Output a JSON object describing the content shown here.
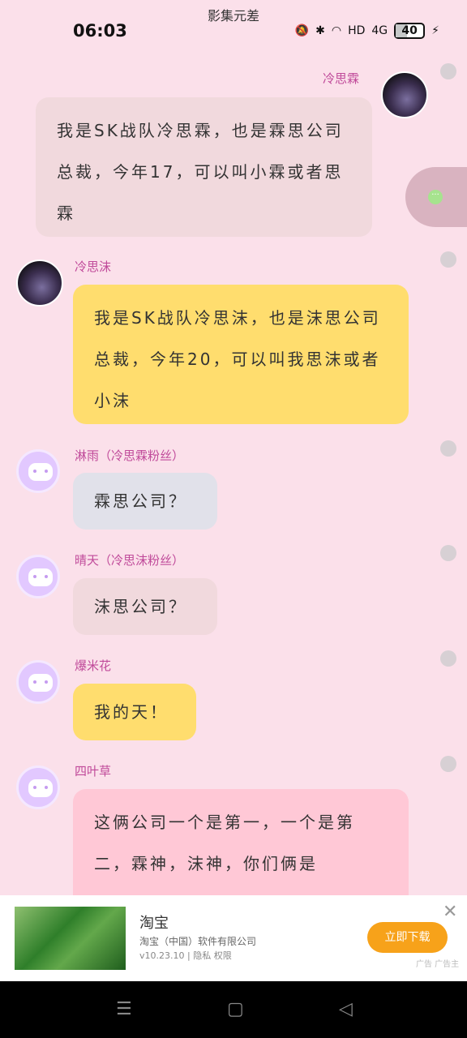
{
  "status_bar": {
    "top_title": "影集元差",
    "time": "06:03",
    "battery": "40",
    "net": "4G",
    "hd": "HD"
  },
  "messages": [
    {
      "name": "冷思霖",
      "text": "我是SK战队冷思霖，也是霖思公司总裁，今年17，可以叫小霖或者思霖",
      "side": "right"
    },
    {
      "name": "冷思沫",
      "text": "我是SK战队冷思沫，也是沫思公司总裁，今年20，可以叫我思沫或者小沫",
      "side": "left"
    },
    {
      "name": "淋雨（冷思霖粉丝）",
      "text": "霖思公司？",
      "side": "left"
    },
    {
      "name": "晴天（冷思沫粉丝）",
      "text": "沫思公司？",
      "side": "left"
    },
    {
      "name": "爆米花",
      "text": "我的天！",
      "side": "left"
    },
    {
      "name": "四叶草",
      "text": "这俩公司一个是第一，一个是第二，霖神，沫神，你们俩是",
      "side": "left"
    }
  ],
  "ad": {
    "title": "淘宝",
    "desc": "淘宝（中国）软件有限公司",
    "version": "v10.23.10 | 隐私 权限",
    "button": "立即下载",
    "tag": "广告 广告主",
    "close": "✕"
  },
  "colors": {
    "background": "#fbe0ea",
    "bubble_gray": "#f1d9dd",
    "bubble_yellow": "#ffdd6e",
    "bubble_blue": "#e1e1ea",
    "bubble_pink": "#ffc8d6",
    "name_color": "#c04a9a"
  },
  "icons": {
    "navbar": [
      "menu-icon",
      "home-icon",
      "back-icon"
    ]
  }
}
